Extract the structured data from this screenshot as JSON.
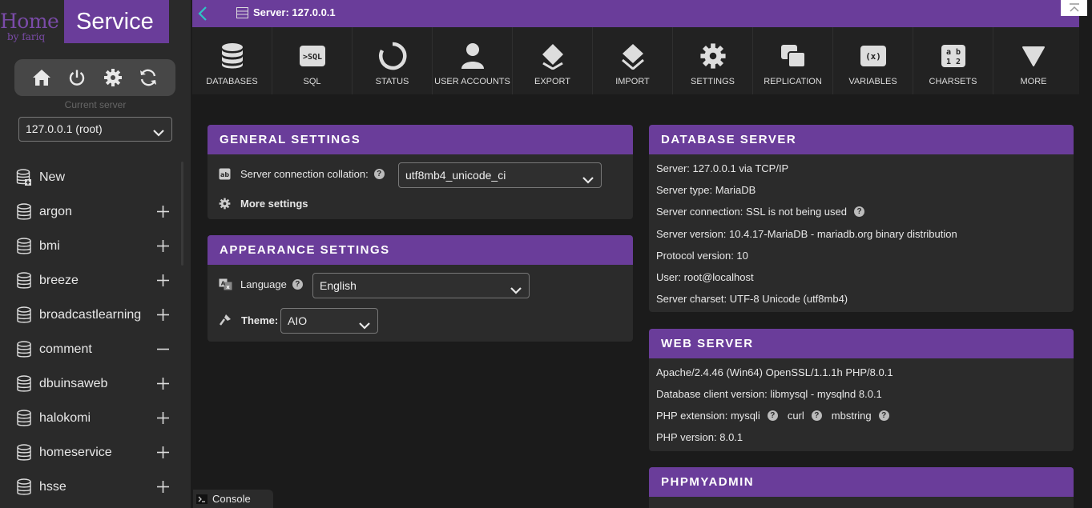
{
  "logo": {
    "home": "Home",
    "by": "by fariq",
    "service": "Service"
  },
  "sidebar": {
    "current_server_label": "Current server",
    "server_value": "127.0.0.1 (root)",
    "new_label": "New",
    "databases": [
      {
        "name": "argon",
        "state": "+"
      },
      {
        "name": "bmi",
        "state": "+"
      },
      {
        "name": "breeze",
        "state": "+"
      },
      {
        "name": "broadcastlearning",
        "state": "+"
      },
      {
        "name": "comment",
        "state": "-"
      },
      {
        "name": "dbuinsaweb",
        "state": "+"
      },
      {
        "name": "halokomi",
        "state": "+"
      },
      {
        "name": "homeservice",
        "state": "+"
      },
      {
        "name": "hsse",
        "state": "+"
      }
    ]
  },
  "topbar": {
    "breadcrumb": "Server: 127.0.0.1"
  },
  "tabs": {
    "databases": "DATABASES",
    "sql": "SQL",
    "status": "STATUS",
    "user_accounts": "USER ACCOUNTS",
    "export": "EXPORT",
    "import": "IMPORT",
    "settings": "SETTINGS",
    "replication": "REPLICATION",
    "variables": "VARIABLES",
    "charsets": "CHARSETS",
    "more": "MORE"
  },
  "general": {
    "title": "GENERAL SETTINGS",
    "collation_label": "Server connection collation:",
    "collation_value": "utf8mb4_unicode_ci",
    "more_settings": "More settings"
  },
  "appearance": {
    "title": "APPEARANCE SETTINGS",
    "language_label": "Language",
    "language_value": "English",
    "theme_label": "Theme:",
    "theme_value": "AIO"
  },
  "db_server": {
    "title": "DATABASE SERVER",
    "lines": [
      "Server: 127.0.0.1 via TCP/IP",
      "Server type: MariaDB",
      "Server connection: SSL is not being used",
      "Server version: 10.4.17-MariaDB - mariadb.org binary distribution",
      "Protocol version: 10",
      "User: root@localhost",
      "Server charset: UTF-8 Unicode (utf8mb4)"
    ]
  },
  "web_server": {
    "title": "WEB SERVER",
    "apache": "Apache/2.4.46 (Win64) OpenSSL/1.1.1h PHP/8.0.1",
    "client": "Database client version: libmysql - mysqlnd 8.0.1",
    "php_ext_label": "PHP extension: mysqli",
    "php_ext_curl": "curl",
    "php_ext_mbstring": "mbstring",
    "php_version": "PHP version: 8.0.1"
  },
  "phpmyadmin": {
    "title": "PHPMYADMIN"
  },
  "console": {
    "label": "Console"
  },
  "colors": {
    "accent": "#6a3d9a",
    "background": "#1b1b1b",
    "panel": "#2b2b2b"
  }
}
